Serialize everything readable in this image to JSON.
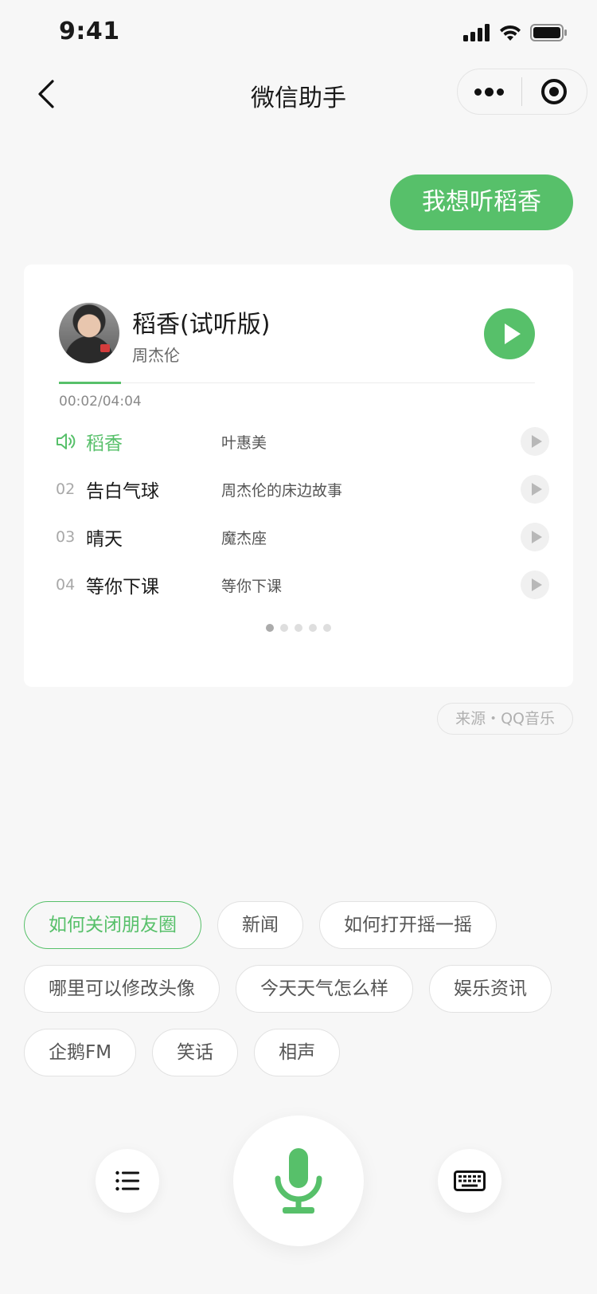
{
  "status_bar": {
    "time": "9:41"
  },
  "nav": {
    "title": "微信助手"
  },
  "user_message": "我想听稻香",
  "player": {
    "song_title": "稻香(试听版)",
    "artist": "周杰伦",
    "time_display": "00:02/04:04",
    "progress_fraction": 0.13
  },
  "tracks": [
    {
      "num": "",
      "name": "稻香",
      "artist": "叶惠美",
      "playing": true
    },
    {
      "num": "02",
      "name": "告白气球",
      "artist": "周杰伦的床边故事",
      "playing": false
    },
    {
      "num": "03",
      "name": "晴天",
      "artist": "魔杰座",
      "playing": false
    },
    {
      "num": "04",
      "name": "等你下课",
      "artist": "等你下课",
      "playing": false
    }
  ],
  "pager": {
    "total": 5,
    "current": 1
  },
  "source": "来源・QQ音乐",
  "suggestions": [
    "如何关闭朋友圈",
    "新闻",
    "如何打开摇一摇",
    "哪里可以修改头像",
    "今天天气怎么样",
    "娱乐资讯",
    "企鹅FM",
    "笑话",
    "相声"
  ],
  "colors": {
    "accent": "#57c06a",
    "background": "#f7f7f7"
  },
  "icons": {
    "back": "chevron-left-icon",
    "more": "more-dots-icon",
    "close": "target-close-icon",
    "speaker": "speaker-icon",
    "list": "list-icon",
    "mic": "microphone-icon",
    "keyboard": "keyboard-icon"
  }
}
